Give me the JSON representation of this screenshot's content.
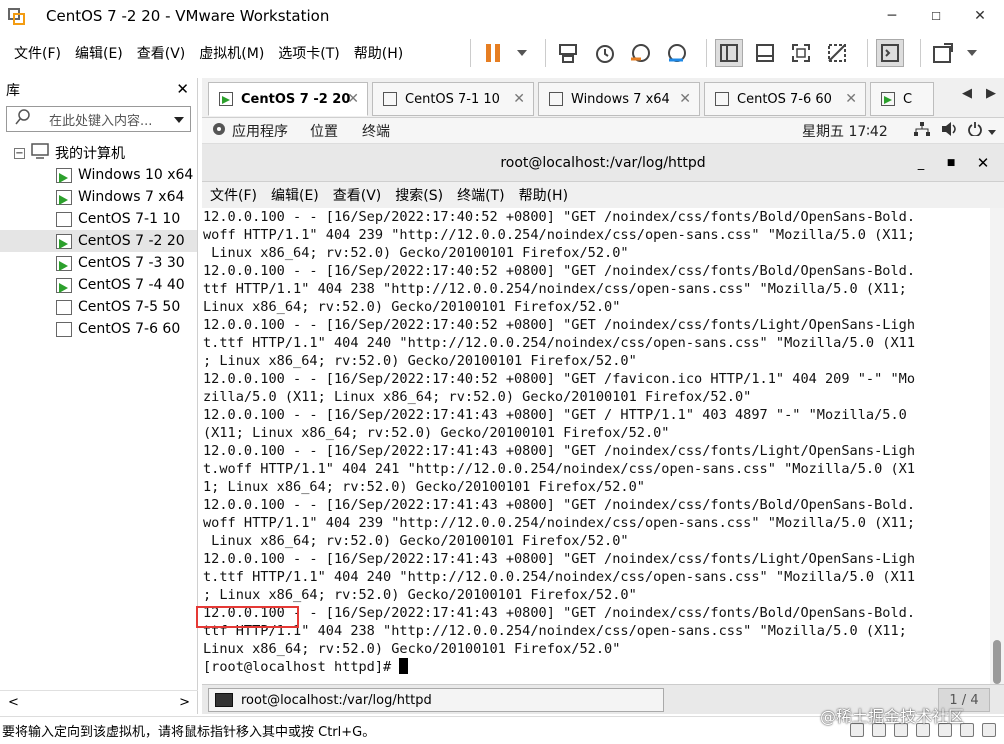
{
  "window": {
    "title": "CentOS 7 -2 20 - VMware Workstation"
  },
  "menubar": {
    "items": [
      "文件(F)",
      "编辑(E)",
      "查看(V)",
      "虚拟机(M)",
      "选项卡(T)",
      "帮助(H)"
    ]
  },
  "toolbar": {
    "icons": [
      "pause-icon",
      "dropdown-icon",
      "send-keys-icon",
      "snapshot-icon",
      "revert-snapshot-icon",
      "snapshot-manager-icon",
      "library-view-icon",
      "thumbnail-view-icon",
      "fullscreen-icon",
      "unity-icon",
      "console-view-icon",
      "stretch-icon"
    ]
  },
  "library": {
    "title": "库",
    "search_placeholder": "在此处键入内容...",
    "root": "我的计算机",
    "items": [
      {
        "label": "Windows 10 x64",
        "running": true,
        "selected": false
      },
      {
        "label": "Windows 7 x64",
        "running": true,
        "selected": false
      },
      {
        "label": "CentOS 7-1  10",
        "running": false,
        "selected": false
      },
      {
        "label": "CentOS 7 -2 20",
        "running": true,
        "selected": true
      },
      {
        "label": "CentOS 7 -3 30",
        "running": true,
        "selected": false
      },
      {
        "label": "CentOS 7 -4 40",
        "running": true,
        "selected": false
      },
      {
        "label": "CentOS 7-5 50",
        "running": false,
        "selected": false
      },
      {
        "label": "CentOS 7-6  60",
        "running": false,
        "selected": false
      }
    ]
  },
  "vm_tabs": [
    {
      "label": "CentOS 7 -2 20",
      "active": true,
      "running": true
    },
    {
      "label": "CentOS 7-1  10",
      "active": false,
      "running": false
    },
    {
      "label": "Windows 7 x64",
      "active": false,
      "running": false
    },
    {
      "label": "CentOS 7-6  60",
      "active": false,
      "running": false
    },
    {
      "label": "C",
      "active": false,
      "running": true
    }
  ],
  "guest_topbar": {
    "applications": "应用程序",
    "places": "位置",
    "terminal": "终端",
    "clock": "星期五 17∶42"
  },
  "terminal": {
    "title": "root@localhost:/var/log/httpd",
    "menu": [
      "文件(F)",
      "编辑(E)",
      "查看(V)",
      "搜索(S)",
      "终端(T)",
      "帮助(H)"
    ],
    "lines": [
      "12.0.0.100 - - [16/Sep/2022:17:40:52 +0800] \"GET /noindex/css/fonts/Bold/OpenSans-Bold.",
      "woff HTTP/1.1\" 404 239 \"http://12.0.0.254/noindex/css/open-sans.css\" \"Mozilla/5.0 (X11;",
      " Linux x86_64; rv:52.0) Gecko/20100101 Firefox/52.0\"",
      "12.0.0.100 - - [16/Sep/2022:17:40:52 +0800] \"GET /noindex/css/fonts/Bold/OpenSans-Bold.",
      "ttf HTTP/1.1\" 404 238 \"http://12.0.0.254/noindex/css/open-sans.css\" \"Mozilla/5.0 (X11;",
      "Linux x86_64; rv:52.0) Gecko/20100101 Firefox/52.0\"",
      "12.0.0.100 - - [16/Sep/2022:17:40:52 +0800] \"GET /noindex/css/fonts/Light/OpenSans-Ligh",
      "t.ttf HTTP/1.1\" 404 240 \"http://12.0.0.254/noindex/css/open-sans.css\" \"Mozilla/5.0 (X11",
      "; Linux x86_64; rv:52.0) Gecko/20100101 Firefox/52.0\"",
      "12.0.0.100 - - [16/Sep/2022:17:40:52 +0800] \"GET /favicon.ico HTTP/1.1\" 404 209 \"-\" \"Mo",
      "zilla/5.0 (X11; Linux x86_64; rv:52.0) Gecko/20100101 Firefox/52.0\"",
      "12.0.0.100 - - [16/Sep/2022:17:41:43 +0800] \"GET / HTTP/1.1\" 403 4897 \"-\" \"Mozilla/5.0",
      "(X11; Linux x86_64; rv:52.0) Gecko/20100101 Firefox/52.0\"",
      "12.0.0.100 - - [16/Sep/2022:17:41:43 +0800] \"GET /noindex/css/fonts/Light/OpenSans-Ligh",
      "t.woff HTTP/1.1\" 404 241 \"http://12.0.0.254/noindex/css/open-sans.css\" \"Mozilla/5.0 (X1",
      "1; Linux x86_64; rv:52.0) Gecko/20100101 Firefox/52.0\"",
      "12.0.0.100 - - [16/Sep/2022:17:41:43 +0800] \"GET /noindex/css/fonts/Bold/OpenSans-Bold.",
      "woff HTTP/1.1\" 404 239 \"http://12.0.0.254/noindex/css/open-sans.css\" \"Mozilla/5.0 (X11;",
      " Linux x86_64; rv:52.0) Gecko/20100101 Firefox/52.0\"",
      "12.0.0.100 - - [16/Sep/2022:17:41:43 +0800] \"GET /noindex/css/fonts/Light/OpenSans-Ligh",
      "t.ttf HTTP/1.1\" 404 240 \"http://12.0.0.254/noindex/css/open-sans.css\" \"Mozilla/5.0 (X11",
      "; Linux x86_64; rv:52.0) Gecko/20100101 Firefox/52.0\"",
      "12.0.0.100 - - [16/Sep/2022:17:41:43 +0800] \"GET /noindex/css/fonts/Bold/OpenSans-Bold.",
      "ttf HTTP/1.1\" 404 238 \"http://12.0.0.254/noindex/css/open-sans.css\" \"Mozilla/5.0 (X11;",
      "Linux x86_64; rv:52.0) Gecko/20100101 Firefox/52.0\""
    ],
    "prompt": "[root@localhost httpd]# "
  },
  "guest_taskbar": {
    "window_label": "root@localhost:/var/log/httpd",
    "workspace": "1 / 4"
  },
  "statusbar": {
    "message": "要将输入定向到该虚拟机，请将鼠标指针移入其中或按 Ctrl+G。"
  },
  "watermark": "@稀土掘金技术社区",
  "colors": {
    "highlight_box": "#e53935",
    "pause_orange": "#e67e22",
    "running_green": "#2ca02c"
  }
}
